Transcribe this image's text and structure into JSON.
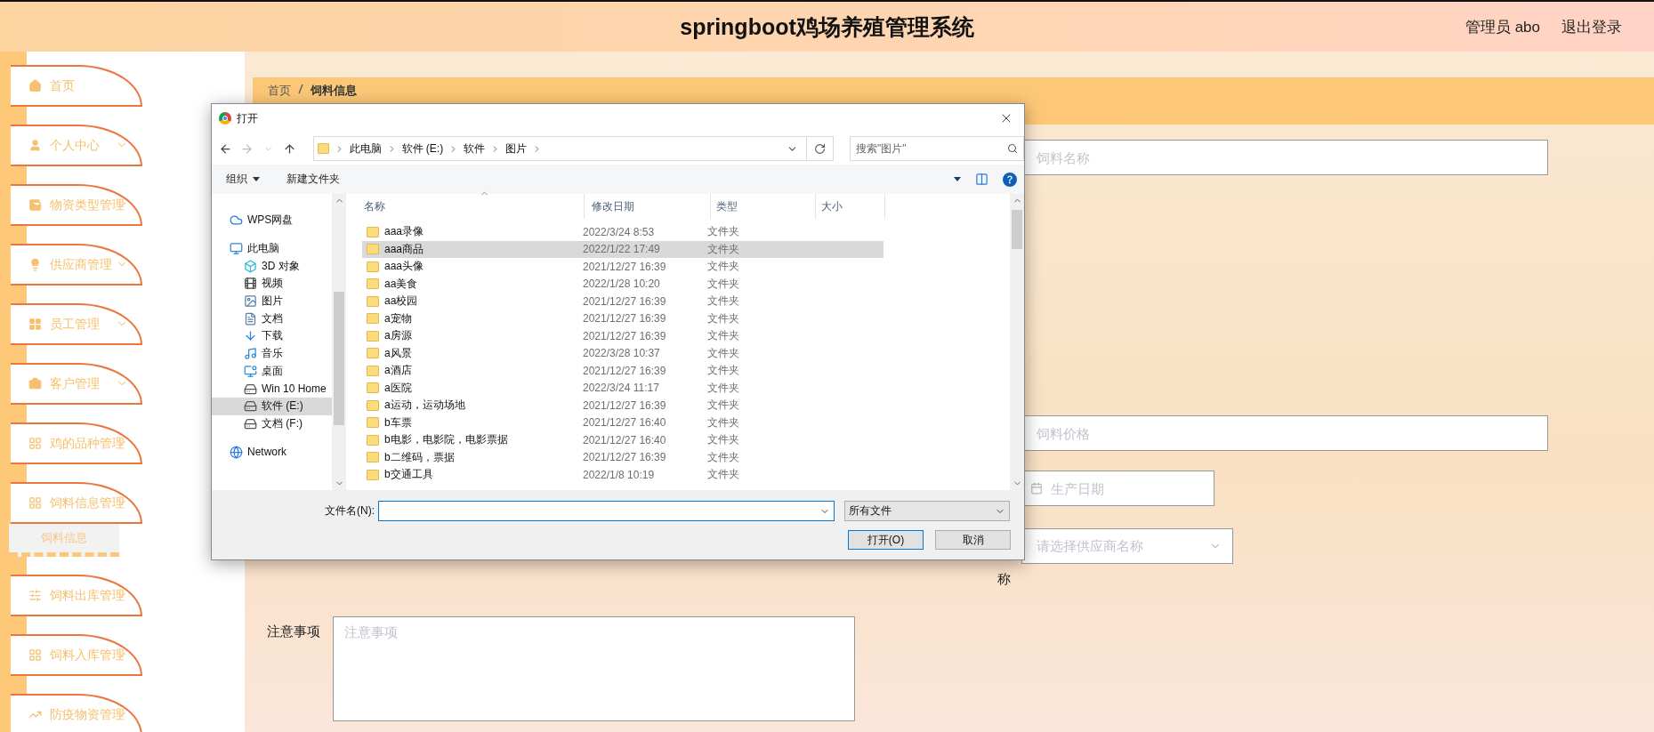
{
  "header": {
    "title": "springboot鸡场养殖管理系统",
    "user": "管理员 abo",
    "logout": "退出登录"
  },
  "sidebar": {
    "items": [
      {
        "label": "首页",
        "arrow": false
      },
      {
        "label": "个人中心",
        "arrow": true
      },
      {
        "label": "物资类型管理",
        "arrow": true
      },
      {
        "label": "供应商管理",
        "arrow": true
      },
      {
        "label": "员工管理",
        "arrow": true
      },
      {
        "label": "客户管理",
        "arrow": true
      },
      {
        "label": "鸡的品种管理",
        "arrow": true
      },
      {
        "label": "饲料信息管理",
        "arrow": true,
        "children": [
          {
            "label": "饲料信息",
            "selected": true
          }
        ]
      },
      {
        "label": "饲料出库管理",
        "arrow": true
      },
      {
        "label": "饲料入库管理",
        "arrow": true
      },
      {
        "label": "防疫物资管理",
        "arrow": true
      }
    ]
  },
  "breadcrumb": [
    "首页",
    "饲料信息"
  ],
  "form": {
    "fields": [
      {
        "kind": "input",
        "placeholder": "饲料名称"
      },
      {
        "kind": "input",
        "placeholder": "饲料价格"
      },
      {
        "kind": "date",
        "placeholder": "生产日期"
      },
      {
        "kind": "select",
        "placeholder": "请选择供应商名称",
        "label": "称"
      }
    ],
    "notes": {
      "label": "注意事项",
      "placeholder": "注意事项"
    }
  },
  "dialog": {
    "title": "打开",
    "path": [
      "此电脑",
      "软件 (E:)",
      "软件",
      "图片"
    ],
    "search_placeholder": "搜索\"图片\"",
    "toolbar": {
      "organize": "组织",
      "new_folder": "新建文件夹"
    },
    "columns": [
      "名称",
      "修改日期",
      "类型",
      "大小"
    ],
    "nav": [
      {
        "label": "WPS网盘",
        "selected": false
      },
      {
        "label": "此电脑",
        "selected": false,
        "children": [
          {
            "label": "3D 对象",
            "selected": false
          },
          {
            "label": "视频",
            "selected": false
          },
          {
            "label": "图片",
            "selected": false
          },
          {
            "label": "文档",
            "selected": false
          },
          {
            "label": "下载",
            "selected": false
          },
          {
            "label": "音乐",
            "selected": false
          },
          {
            "label": "桌面",
            "selected": false
          },
          {
            "label": "Win 10 Home",
            "selected": false
          },
          {
            "label": "软件 (E:)",
            "selected": true
          },
          {
            "label": "文档 (F:)",
            "selected": false
          }
        ]
      },
      {
        "label": "Network",
        "selected": false
      }
    ],
    "files": [
      {
        "name": "aaa录像",
        "date": "2022/3/24 8:53",
        "type": "文件夹",
        "selected": false
      },
      {
        "name": "aaa商品",
        "date": "2022/1/22 17:49",
        "type": "文件夹",
        "selected": true
      },
      {
        "name": "aaa头像",
        "date": "2021/12/27 16:39",
        "type": "文件夹",
        "selected": false
      },
      {
        "name": "aa美食",
        "date": "2022/1/28 10:20",
        "type": "文件夹",
        "selected": false
      },
      {
        "name": "aa校园",
        "date": "2021/12/27 16:39",
        "type": "文件夹",
        "selected": false
      },
      {
        "name": "a宠物",
        "date": "2021/12/27 16:39",
        "type": "文件夹",
        "selected": false
      },
      {
        "name": "a房源",
        "date": "2021/12/27 16:39",
        "type": "文件夹",
        "selected": false
      },
      {
        "name": "a风景",
        "date": "2022/3/28 10:37",
        "type": "文件夹",
        "selected": false
      },
      {
        "name": "a酒店",
        "date": "2021/12/27 16:39",
        "type": "文件夹",
        "selected": false
      },
      {
        "name": "a医院",
        "date": "2022/3/24 11:17",
        "type": "文件夹",
        "selected": false
      },
      {
        "name": "a运动，运动场地",
        "date": "2021/12/27 16:39",
        "type": "文件夹",
        "selected": false
      },
      {
        "name": "b车票",
        "date": "2021/12/27 16:40",
        "type": "文件夹",
        "selected": false
      },
      {
        "name": "b电影，电影院，电影票据",
        "date": "2021/12/27 16:40",
        "type": "文件夹",
        "selected": false
      },
      {
        "name": "b二维码，票据",
        "date": "2021/12/27 16:39",
        "type": "文件夹",
        "selected": false
      },
      {
        "name": "b交通工具",
        "date": "2022/1/8 10:19",
        "type": "文件夹",
        "selected": false
      }
    ],
    "filename_label": "文件名(N):",
    "filetype": "所有文件",
    "buttons": [
      {
        "label": "打开(O)",
        "primary": true
      },
      {
        "label": "取消",
        "primary": false
      }
    ]
  }
}
